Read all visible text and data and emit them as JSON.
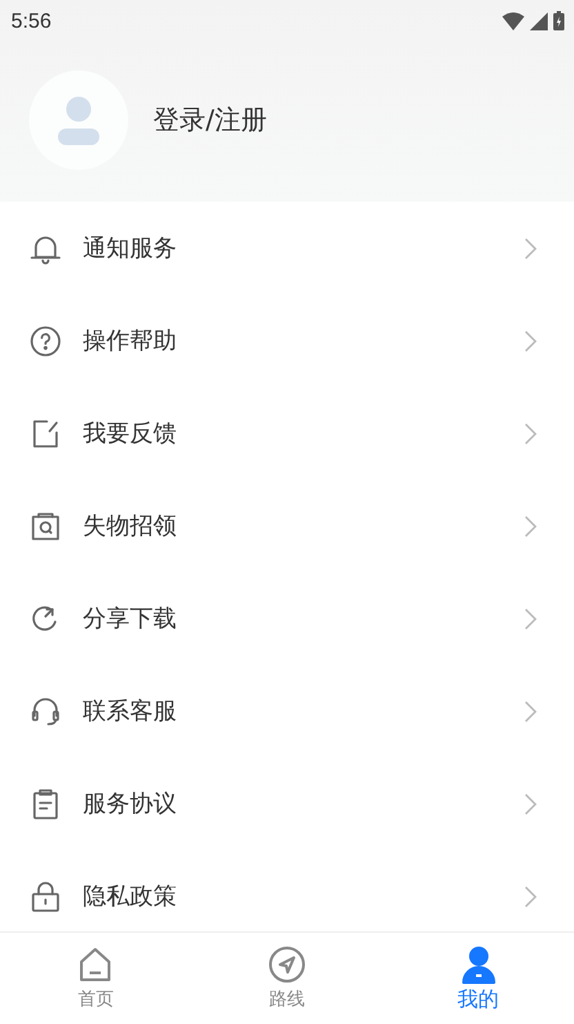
{
  "status_bar": {
    "time": "5:56"
  },
  "profile": {
    "login_label": "登录/注册"
  },
  "menu": [
    {
      "label": "通知服务"
    },
    {
      "label": "操作帮助"
    },
    {
      "label": "我要反馈"
    },
    {
      "label": "失物招领"
    },
    {
      "label": "分享下载"
    },
    {
      "label": "联系客服"
    },
    {
      "label": "服务协议"
    },
    {
      "label": "隐私政策"
    }
  ],
  "tab_bar": [
    {
      "label": "首页",
      "selected": false
    },
    {
      "label": "路线",
      "selected": false
    },
    {
      "label": "我的",
      "selected": true
    }
  ]
}
